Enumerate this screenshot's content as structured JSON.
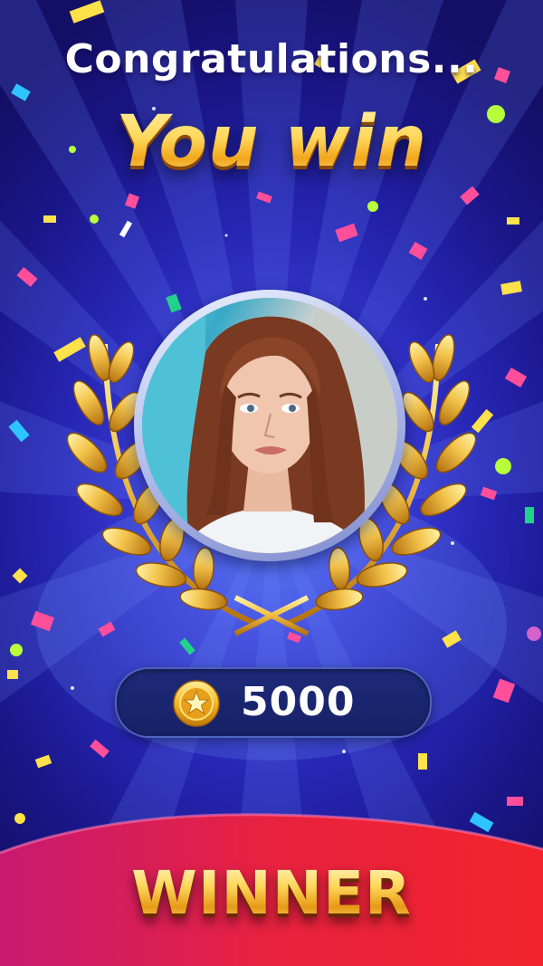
{
  "header": {
    "line1": "Congratulations...",
    "line2": "You win"
  },
  "player": {
    "avatar_icon": "player-avatar-photo"
  },
  "reward": {
    "coin_icon": "star-coin-icon",
    "amount": "5000"
  },
  "footer": {
    "banner_text": "WINNER"
  },
  "colors": {
    "background": "#2626b4",
    "gold": "#ffd75a",
    "banner_red": "#e8222f",
    "banner_pink": "#c81a72",
    "score_pill": "#1b2672"
  }
}
